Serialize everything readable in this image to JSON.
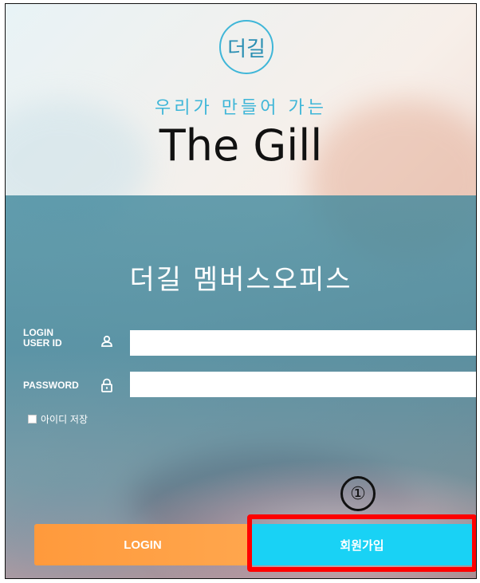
{
  "branding": {
    "logo_text": "더길",
    "subtitle": "우리가 만들어 가는",
    "title": "The Gill",
    "office_title": "더길 멤버스오피스"
  },
  "form": {
    "user_id_label": "LOGIN\nUSER ID",
    "password_label": "PASSWORD",
    "user_id_value": "",
    "password_value": "",
    "remember_label": "아이디 저장",
    "remember_checked": false
  },
  "buttons": {
    "login": "LOGIN",
    "signup": "회원가입"
  },
  "annotation": {
    "step_marker": "①"
  },
  "colors": {
    "accent": "#3fb6d8",
    "login_button": "#ff9a3c",
    "signup_button": "#19d2f5",
    "highlight": "#ff0000"
  }
}
